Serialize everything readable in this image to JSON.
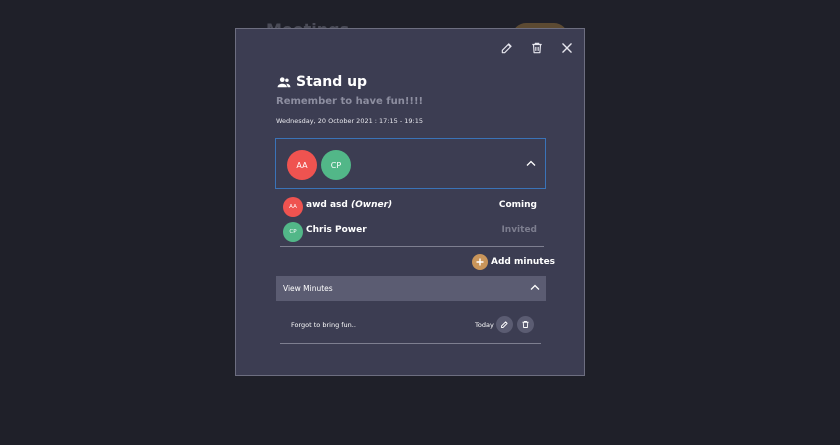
{
  "background": {
    "page_title": "Meetings"
  },
  "event": {
    "title": "Stand up",
    "description": "Remember to have fun!!!!",
    "datetime": "Wednesday, 20 October 2021 : 17:15 - 19:15"
  },
  "attendees_summary": [
    {
      "initials": "AA",
      "color": "#ef5350"
    },
    {
      "initials": "CP",
      "color": "#52b788"
    }
  ],
  "attendees": [
    {
      "initials": "AA",
      "name": "awd asd",
      "role": "(Owner)",
      "status": "Coming"
    },
    {
      "initials": "CP",
      "name": "Chris Power",
      "role": "",
      "status": "Invited"
    }
  ],
  "actions": {
    "add_minutes": "Add minutes",
    "view_minutes": "View Minutes"
  },
  "minutes": [
    {
      "text": "Forgot to bring fun..",
      "date": "Today"
    }
  ],
  "icons": {
    "edit": "pencil-icon",
    "delete": "trash-icon",
    "close": "close-icon",
    "group": "people-icon",
    "expand": "chevron-up-icon",
    "add": "plus-icon"
  },
  "colors": {
    "background": "#1f2029",
    "modal": "#3c3d52",
    "accent_orange": "#c9955a",
    "focus_border": "#3a73b8",
    "owner_avatar": "#ef5350",
    "invitee_avatar": "#52b788"
  }
}
